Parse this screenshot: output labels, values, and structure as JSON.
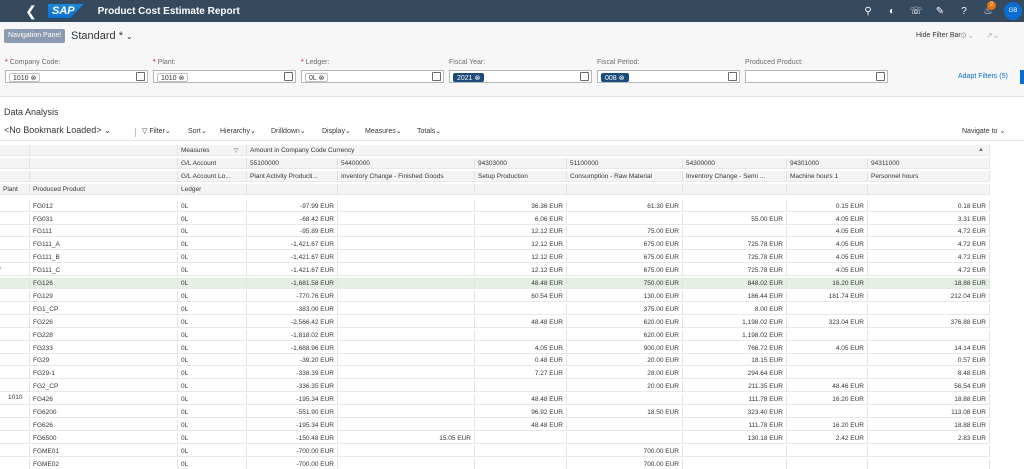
{
  "shell": {
    "title": "Product Cost Estimate Report",
    "notification_count": "2",
    "avatar_initials": "GB",
    "bg": "#354a5f"
  },
  "header": {
    "navigation_panel": "Navigation Panel",
    "variant": "Standard *",
    "hide_filter_bar": "Hide Filter Bar",
    "adapt_filters": "Adapt Filters (5)",
    "filters": [
      {
        "label": "Company Code:",
        "required": true,
        "tokens": [
          "1010"
        ]
      },
      {
        "label": "Plant:",
        "required": true,
        "tokens": [
          "1010"
        ]
      },
      {
        "label": "Ledger:",
        "required": true,
        "tokens": [
          "0L"
        ]
      },
      {
        "label": "Fiscal Year:",
        "required": false,
        "tokens": [
          "2021"
        ]
      },
      {
        "label": "Fiscal Period:",
        "required": false,
        "tokens": [
          "008"
        ]
      },
      {
        "label": "Produced Product:",
        "required": false,
        "tokens": []
      }
    ]
  },
  "data_analysis": {
    "title": "Data Analysis",
    "bookmark": "<No Bookmark Loaded>",
    "toolbar": [
      "Filter",
      "Sort",
      "Hierarchy",
      "Drilldown",
      "Display",
      "Measures",
      "Totals"
    ],
    "navigate_to": "Navigate to"
  },
  "table": {
    "dim_headers": {
      "measures": "Measures",
      "gl_account": "G/L Account",
      "gl_account_long": "G/L Account Lo...",
      "ledger": "Ledger",
      "plant": "Plant",
      "produced_product": "Produced Product",
      "amount_header": "Amount in Company Code Currency"
    },
    "columns": [
      {
        "account": "55100000",
        "name": "Plant Activity Producti..."
      },
      {
        "account": "54400000",
        "name": "Inventory Change - Finished Goods"
      },
      {
        "account": "94303000",
        "name": "Setup Production"
      },
      {
        "account": "51100000",
        "name": "Consumption - Raw Material"
      },
      {
        "account": "54300000",
        "name": "Inventory Change - Semi ..."
      },
      {
        "account": "94301000",
        "name": "Machine hours 1"
      },
      {
        "account": "94311000",
        "name": "Personnel hours"
      }
    ],
    "plant_value": "1010",
    "plant_partial": "0",
    "highlight_row": "FG126",
    "rows": [
      {
        "product": "FG012",
        "ledger": "0L",
        "values": [
          "-97.99 EUR",
          "",
          "36.36 EUR",
          "61.30 EUR",
          "",
          "0.15 EUR",
          "0.18 EUR"
        ]
      },
      {
        "product": "FG031",
        "ledger": "0L",
        "values": [
          "-68.42 EUR",
          "",
          "6.06 EUR",
          "",
          "55.00 EUR",
          "4.05 EUR",
          "3.31 EUR"
        ]
      },
      {
        "product": "FG111",
        "ledger": "0L",
        "values": [
          "-95.89 EUR",
          "",
          "12.12 EUR",
          "75.00 EUR",
          "",
          "4.05 EUR",
          "4.72 EUR"
        ]
      },
      {
        "product": "FG111_A",
        "ledger": "0L",
        "values": [
          "-1,421.67 EUR",
          "",
          "12.12 EUR",
          "675.00 EUR",
          "725.78 EUR",
          "4.05 EUR",
          "4.72 EUR"
        ]
      },
      {
        "product": "FG111_B",
        "ledger": "0L",
        "values": [
          "-1,421.67 EUR",
          "",
          "12.12 EUR",
          "675.00 EUR",
          "725.78 EUR",
          "4.05 EUR",
          "4.72 EUR"
        ]
      },
      {
        "product": "FG111_C",
        "ledger": "0L",
        "values": [
          "-1,421.67 EUR",
          "",
          "12.12 EUR",
          "675.00 EUR",
          "725.78 EUR",
          "4.05 EUR",
          "4.72 EUR"
        ]
      },
      {
        "product": "FG126",
        "ledger": "0L",
        "values": [
          "-1,681.58 EUR",
          "",
          "48.48 EUR",
          "750.00 EUR",
          "848.02 EUR",
          "16.20 EUR",
          "18.88 EUR"
        ]
      },
      {
        "product": "FG129",
        "ledger": "0L",
        "values": [
          "-770.76 EUR",
          "",
          "60.54 EUR",
          "130.00 EUR",
          "186.44 EUR",
          "181.74 EUR",
          "212.04 EUR"
        ]
      },
      {
        "product": "FG1_CP",
        "ledger": "0L",
        "values": [
          "-383.00 EUR",
          "",
          "",
          "375.00 EUR",
          "8.00 EUR",
          "",
          ""
        ]
      },
      {
        "product": "FG226",
        "ledger": "0L",
        "values": [
          "-2,566.42 EUR",
          "",
          "48.48 EUR",
          "620.00 EUR",
          "1,198.02 EUR",
          "323.04 EUR",
          "376.88 EUR"
        ]
      },
      {
        "product": "FG228",
        "ledger": "0L",
        "values": [
          "-1,818.02 EUR",
          "",
          "",
          "620.00 EUR",
          "1,198.02 EUR",
          "",
          ""
        ]
      },
      {
        "product": "FG233",
        "ledger": "0L",
        "values": [
          "-1,688.96 EUR",
          "",
          "4.05 EUR",
          "900.00 EUR",
          "766.72 EUR",
          "4.05 EUR",
          "14.14 EUR"
        ]
      },
      {
        "product": "FG29",
        "ledger": "0L",
        "values": [
          "-39.20 EUR",
          "",
          "0.48 EUR",
          "20.00 EUR",
          "18.15 EUR",
          "",
          "0.57 EUR"
        ]
      },
      {
        "product": "FG29-1",
        "ledger": "0L",
        "values": [
          "-338.39 EUR",
          "",
          "7.27 EUR",
          "28.00 EUR",
          "294.64 EUR",
          "",
          "8.48 EUR"
        ]
      },
      {
        "product": "FG2_CP",
        "ledger": "0L",
        "values": [
          "-336.35 EUR",
          "",
          "",
          "20.00 EUR",
          "211.35 EUR",
          "48.46 EUR",
          "56.54 EUR"
        ]
      },
      {
        "product": "FG426",
        "ledger": "0L",
        "values": [
          "-195.34 EUR",
          "",
          "48.48 EUR",
          "",
          "111.78 EUR",
          "16.20 EUR",
          "18.88 EUR"
        ]
      },
      {
        "product": "FG6200",
        "ledger": "0L",
        "values": [
          "-551.90 EUR",
          "",
          "96.92 EUR",
          "18.50 EUR",
          "323.40 EUR",
          "",
          "113.08 EUR"
        ]
      },
      {
        "product": "FG626",
        "ledger": "0L",
        "values": [
          "-195.34 EUR",
          "",
          "48.48 EUR",
          "",
          "111.78 EUR",
          "16.20 EUR",
          "18.88 EUR"
        ]
      },
      {
        "product": "FG6500",
        "ledger": "0L",
        "values": [
          "-150.48 EUR",
          "15.05 EUR",
          "",
          "",
          "130.18 EUR",
          "2.42 EUR",
          "2.83 EUR"
        ]
      },
      {
        "product": "FGME01",
        "ledger": "0L",
        "values": [
          "-700.00 EUR",
          "",
          "",
          "700.00 EUR",
          "",
          "",
          ""
        ]
      },
      {
        "product": "FGME02",
        "ledger": "0L",
        "values": [
          "-700.00 EUR",
          "",
          "",
          "700.00 EUR",
          "",
          "",
          ""
        ]
      }
    ]
  }
}
